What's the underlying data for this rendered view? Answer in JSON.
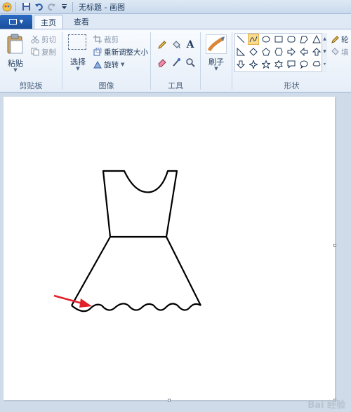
{
  "window": {
    "title": "无标题 - 画图"
  },
  "tabs": [
    {
      "label": "主页",
      "active": true
    },
    {
      "label": "查看",
      "active": false
    }
  ],
  "clipboard": {
    "group_label": "剪贴板",
    "paste_label": "粘贴",
    "cut_label": "剪切",
    "copy_label": "复制"
  },
  "image": {
    "group_label": "图像",
    "select_label": "选择",
    "crop_label": "裁剪",
    "resize_label": "重新调整大小",
    "rotate_label": "旋转"
  },
  "tools": {
    "group_label": "工具",
    "items": [
      "pencil-icon",
      "fill-icon",
      "text-icon",
      "eraser-icon",
      "color-picker-icon",
      "magnifier-icon"
    ],
    "text_glyph": "A"
  },
  "brushes": {
    "label": "刷子"
  },
  "shapes": {
    "group_label": "形状",
    "selected": "curve",
    "outline_label": "轮",
    "fill_label": "填"
  },
  "watermark": {
    "text": "Bai 经验"
  },
  "colors": {
    "accent": "#2b6bc3",
    "selected_shape": "#fcdc8c",
    "arrow": "#e0202a",
    "drawing": "#000000"
  }
}
